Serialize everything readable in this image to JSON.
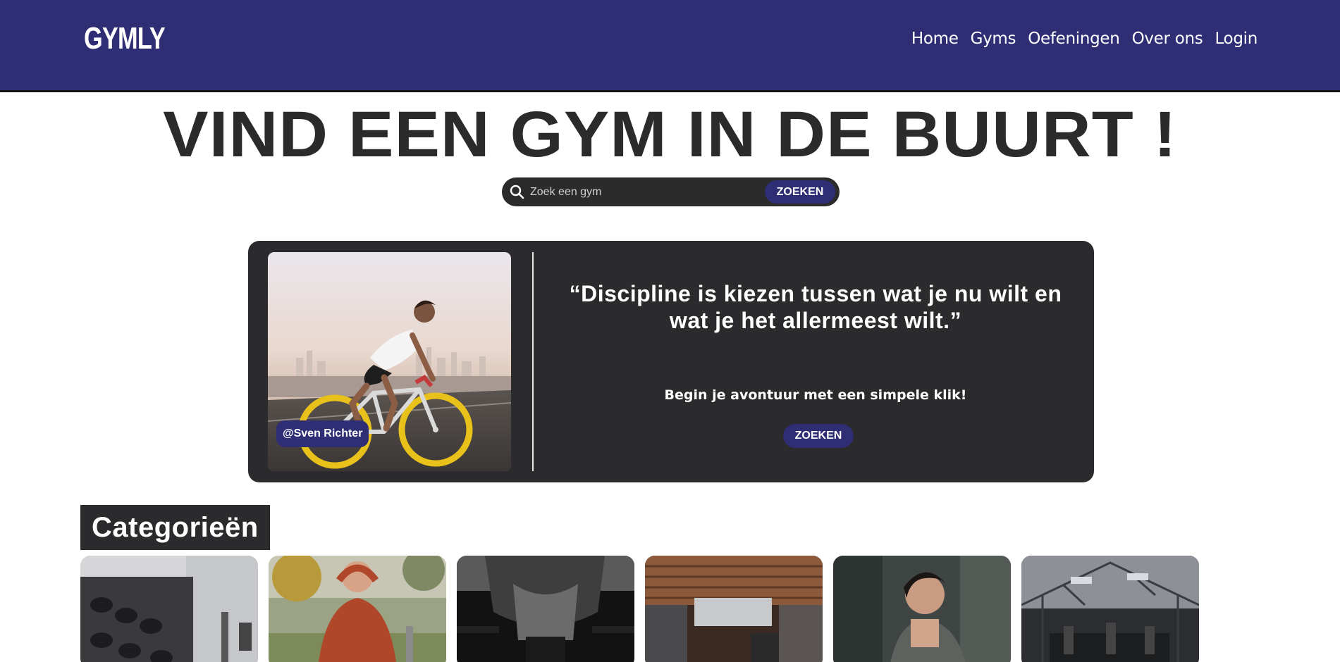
{
  "header": {
    "logo": "GYMLY",
    "nav": [
      "Home",
      "Gyms",
      "Oefeningen",
      "Over ons",
      "Login"
    ]
  },
  "hero": {
    "title": "VIND EEN GYM IN DE BUURT !"
  },
  "search": {
    "placeholder": "Zoek een gym",
    "button": "ZOEKEN"
  },
  "quote_card": {
    "photo_credit": "@Sven Richter",
    "quote": "“Discipline is kiezen tussen wat je nu wilt en wat je het allermeest wilt.”",
    "subline": "Begin je avontuur met een simpele klik!",
    "button": "ZOEKEN"
  },
  "categories": {
    "title": "Categorieën"
  },
  "colors": {
    "brand": "#2f2d74",
    "dark": "#2b2a2c",
    "white": "#ffffff"
  }
}
